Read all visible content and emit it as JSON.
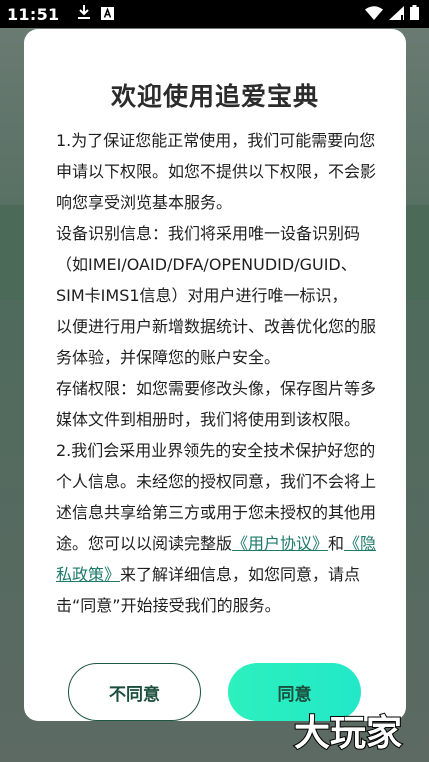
{
  "status_bar": {
    "time": "11:51",
    "left_icons": [
      "download-icon",
      "keyboard-a-icon"
    ],
    "right_icons": [
      "wifi-icon",
      "signal-icon",
      "battery-icon"
    ]
  },
  "dialog": {
    "title": "欢迎使用追爱宝典",
    "paragraphs": {
      "p1": "1.为了保证您能正常使用，我们可能需要向您申请以下权限。如您不提供以下权限，不会影响您享受浏览基本服务。",
      "p2a": "设备识别信息：我们将采用唯一设备识别码（如IMEI/OAID/DFA/OPENUDID/GUID、SIM卡IMS1信息）对用户进行唯一标识，",
      "p2b": "以便进行用户新增数据统计、改善优化您的服务体验，并保障您的账户安全。",
      "p3": "存储权限：如您需要修改头像，保存图片等多媒体文件到相册时，我们将使用到该权限。",
      "p4_pre": "2.我们会采用业界领先的安全技术保护好您的个人信息。未经您的授权同意，我们不会将上述信息共享给第三方或用于您未授权的其他用途。您可以以阅读完整版",
      "link_user_agreement": "《用户协议》",
      "p4_and": "和",
      "link_privacy_policy": "《隐私政策》",
      "p4_post": "来了解详细信息，如您同意，请点击“同意”开始接受我们的服务。"
    },
    "buttons": {
      "disagree": "不同意",
      "agree": "同意"
    }
  },
  "watermark": "大玩家",
  "colors": {
    "agree_button": "#2cf0bd",
    "link": "#1d7a6a",
    "disagree_border": "#1e5645"
  }
}
